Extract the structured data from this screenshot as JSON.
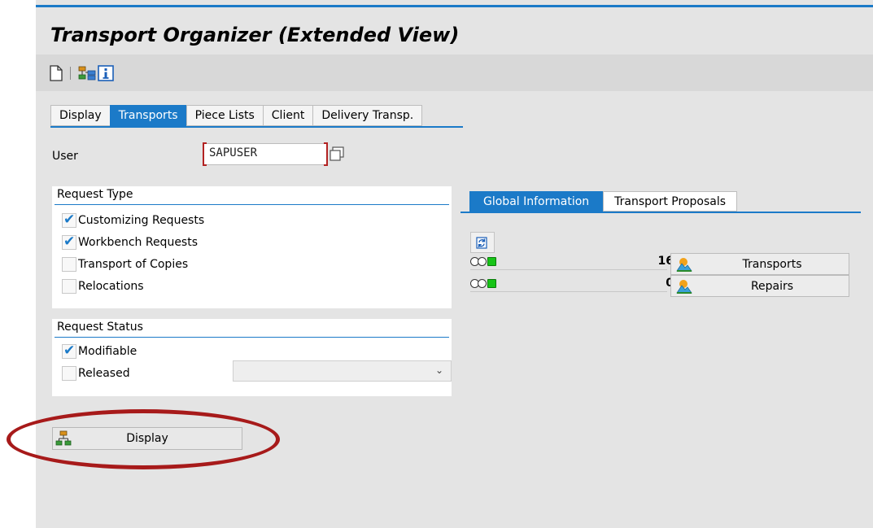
{
  "window": {
    "title": "Transport Organizer (Extended View)"
  },
  "toolbar": {
    "icons": [
      "new-document-icon",
      "hierarchy-icon",
      "info-icon"
    ]
  },
  "tabs": [
    {
      "label": "Display",
      "active": false
    },
    {
      "label": "Transports",
      "active": true
    },
    {
      "label": "Piece Lists",
      "active": false
    },
    {
      "label": "Client",
      "active": false
    },
    {
      "label": "Delivery Transp.",
      "active": false
    }
  ],
  "user": {
    "label": "User",
    "value": "SAPUSER"
  },
  "request_type": {
    "title": "Request Type",
    "options": [
      {
        "label": "Customizing Requests",
        "checked": true
      },
      {
        "label": "Workbench Requests",
        "checked": true
      },
      {
        "label": "Transport of Copies",
        "checked": false
      },
      {
        "label": "Relocations",
        "checked": false
      }
    ]
  },
  "request_status": {
    "title": "Request Status",
    "options": [
      {
        "label": "Modifiable",
        "checked": true
      },
      {
        "label": "Released",
        "checked": false
      }
    ],
    "released_select_value": ""
  },
  "display_button": {
    "label": "Display"
  },
  "right_tabs": [
    {
      "label": "Global Information",
      "active": true
    },
    {
      "label": "Transport Proposals",
      "active": false
    }
  ],
  "global_info": {
    "rows": [
      {
        "count": "16",
        "button_label": "Transports",
        "status": "green"
      },
      {
        "count": "0",
        "button_label": "Repairs",
        "status": "green"
      }
    ]
  },
  "colors": {
    "accent": "#1b7ac8",
    "highlight_ellipse": "#a71a1a",
    "background": "#e4e4e4"
  }
}
